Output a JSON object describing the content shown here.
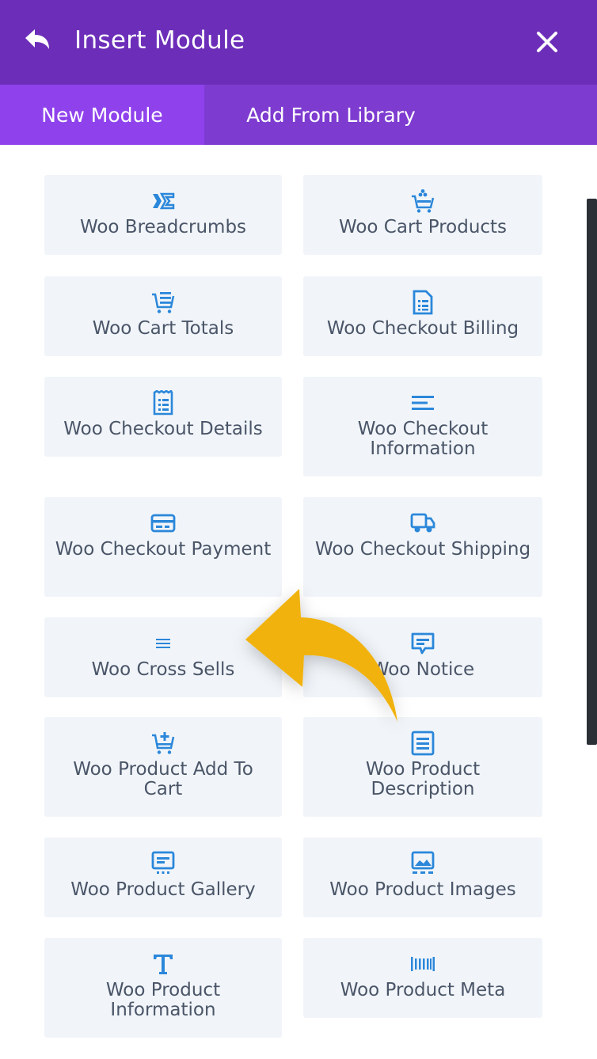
{
  "header": {
    "title": "Insert Module",
    "back_icon": "undo-arrow-icon",
    "close_icon": "close-icon"
  },
  "tabs": [
    {
      "label": "New Module",
      "active": true
    },
    {
      "label": "Add From Library",
      "active": false
    }
  ],
  "accent_colors": {
    "header": "#6c2eb9",
    "tabs": "#7e3bd0",
    "active_tab": "#8f42ec",
    "icon": "#2b87da",
    "card_bg": "#f1f5f9",
    "arrow": "#f1b20c"
  },
  "modules": [
    {
      "label": "Woo Breadcrumbs",
      "icon": "breadcrumbs-icon"
    },
    {
      "label": "Woo Cart Products",
      "icon": "cart-products-icon"
    },
    {
      "label": "Woo Cart Totals",
      "icon": "cart-totals-icon"
    },
    {
      "label": "Woo Checkout Billing",
      "icon": "billing-document-icon"
    },
    {
      "label": "Woo Checkout Details",
      "icon": "receipt-icon"
    },
    {
      "label": "Woo Checkout Information",
      "icon": "text-lines-icon"
    },
    {
      "label": "Woo Checkout Payment",
      "icon": "credit-card-icon"
    },
    {
      "label": "Woo Checkout Shipping",
      "icon": "truck-icon"
    },
    {
      "label": "Woo Cross Sells",
      "icon": "menu-lines-icon"
    },
    {
      "label": "Woo Notice",
      "icon": "chat-bubble-icon"
    },
    {
      "label": "Woo Product Add To Cart",
      "icon": "cart-add-icon"
    },
    {
      "label": "Woo Product Description",
      "icon": "description-icon"
    },
    {
      "label": "Woo Product Gallery",
      "icon": "gallery-icon"
    },
    {
      "label": "Woo Product Images",
      "icon": "image-icon"
    },
    {
      "label": "Woo Product Information",
      "icon": "text-t-icon"
    },
    {
      "label": "Woo Product Meta",
      "icon": "barcode-icon"
    }
  ]
}
